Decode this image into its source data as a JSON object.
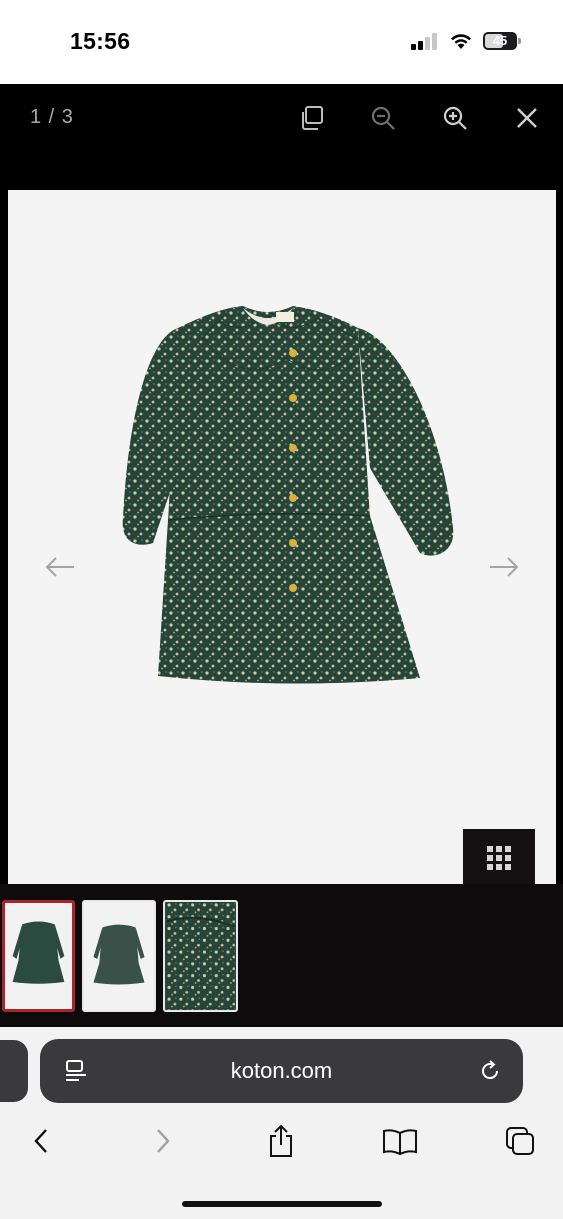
{
  "status_bar": {
    "time": "15:56",
    "battery_level": "45",
    "icons": [
      "signal-icon",
      "wifi-icon",
      "battery-icon"
    ]
  },
  "viewer": {
    "counter": "1 / 3",
    "toolbar": [
      "copy-icon",
      "zoom-out-icon",
      "zoom-in-icon",
      "close-icon"
    ],
    "prev_icon": "arrow-left-icon",
    "next_icon": "arrow-right-icon",
    "grid_icon": "grid-icon",
    "thumbnails": [
      {
        "name": "thumbnail-1",
        "active": true
      },
      {
        "name": "thumbnail-2",
        "active": false
      },
      {
        "name": "thumbnail-3",
        "active": false
      }
    ],
    "accent_color": "#b0222a"
  },
  "browser": {
    "url": "koton.com",
    "icons": [
      "page-menu-icon",
      "reload-icon",
      "back-icon",
      "forward-icon",
      "share-icon",
      "bookmarks-icon",
      "tabs-icon"
    ]
  }
}
